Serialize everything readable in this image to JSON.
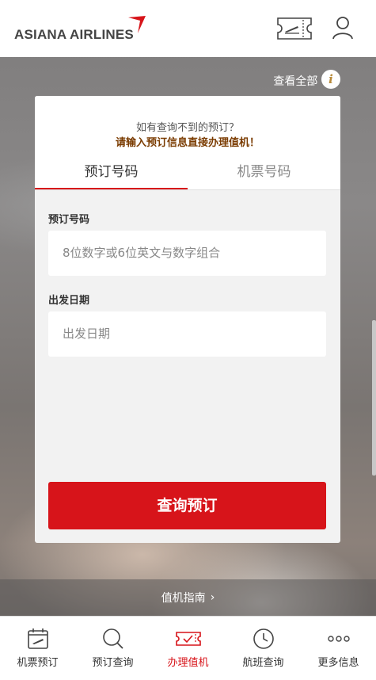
{
  "header": {
    "logo_text": "ASIANA AIRLINES",
    "ticket_icon": "boarding-pass-icon",
    "user_icon": "user-icon",
    "view_all": "查看全部"
  },
  "card": {
    "notice_line1": "如有查询不到的预订？",
    "notice_line2": "请输入预订信息直接办理值机！",
    "tabs": [
      {
        "label": "预订号码",
        "active": true
      },
      {
        "label": "机票号码",
        "active": false
      }
    ],
    "fields": {
      "booking_label": "预订号码",
      "booking_placeholder": "8位数字或6位英文与数字组合",
      "date_label": "出发日期",
      "date_placeholder": "出发日期"
    },
    "submit_label": "查询预订"
  },
  "guide": {
    "label": "值机指南"
  },
  "tabbar": {
    "items": [
      {
        "label": "机票预订",
        "icon": "calendar-plane-icon",
        "active": false
      },
      {
        "label": "预订查询",
        "icon": "search-icon",
        "active": false
      },
      {
        "label": "办理值机",
        "icon": "ticket-check-icon",
        "active": true
      },
      {
        "label": "航班查询",
        "icon": "clock-icon",
        "active": false
      },
      {
        "label": "更多信息",
        "icon": "more-dots-icon",
        "active": false
      }
    ]
  },
  "colors": {
    "accent": "#d7141a",
    "notice": "#7a3b00"
  }
}
